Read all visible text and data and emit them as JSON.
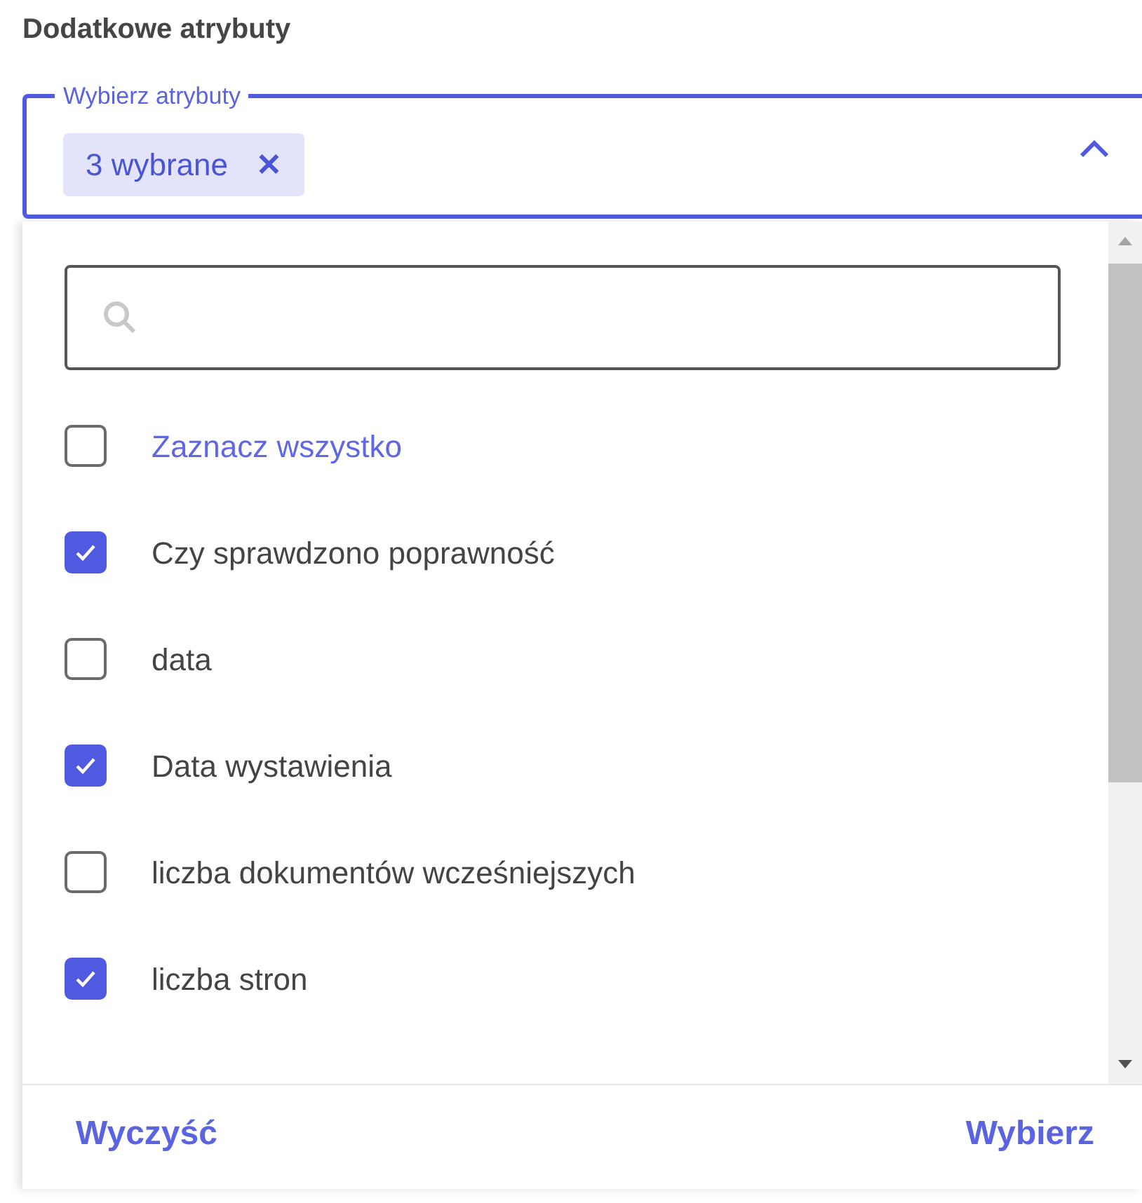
{
  "heading": "Dodatkowe atrybuty",
  "select": {
    "label": "Wybierz atrybuty",
    "chip": "3 wybrane",
    "chip_remove": "✕",
    "expanded": true
  },
  "select_all": {
    "label": "Zaznacz wszystko",
    "checked": false
  },
  "options": [
    {
      "label": "Czy sprawdzono poprawność",
      "checked": true
    },
    {
      "label": "data",
      "checked": false
    },
    {
      "label": "Data wystawienia",
      "checked": true
    },
    {
      "label": "liczba dokumentów wcześniejszych",
      "checked": false
    },
    {
      "label": "liczba stron",
      "checked": true
    }
  ],
  "footer": {
    "clear": "Wyczyść",
    "confirm": "Wybierz"
  }
}
